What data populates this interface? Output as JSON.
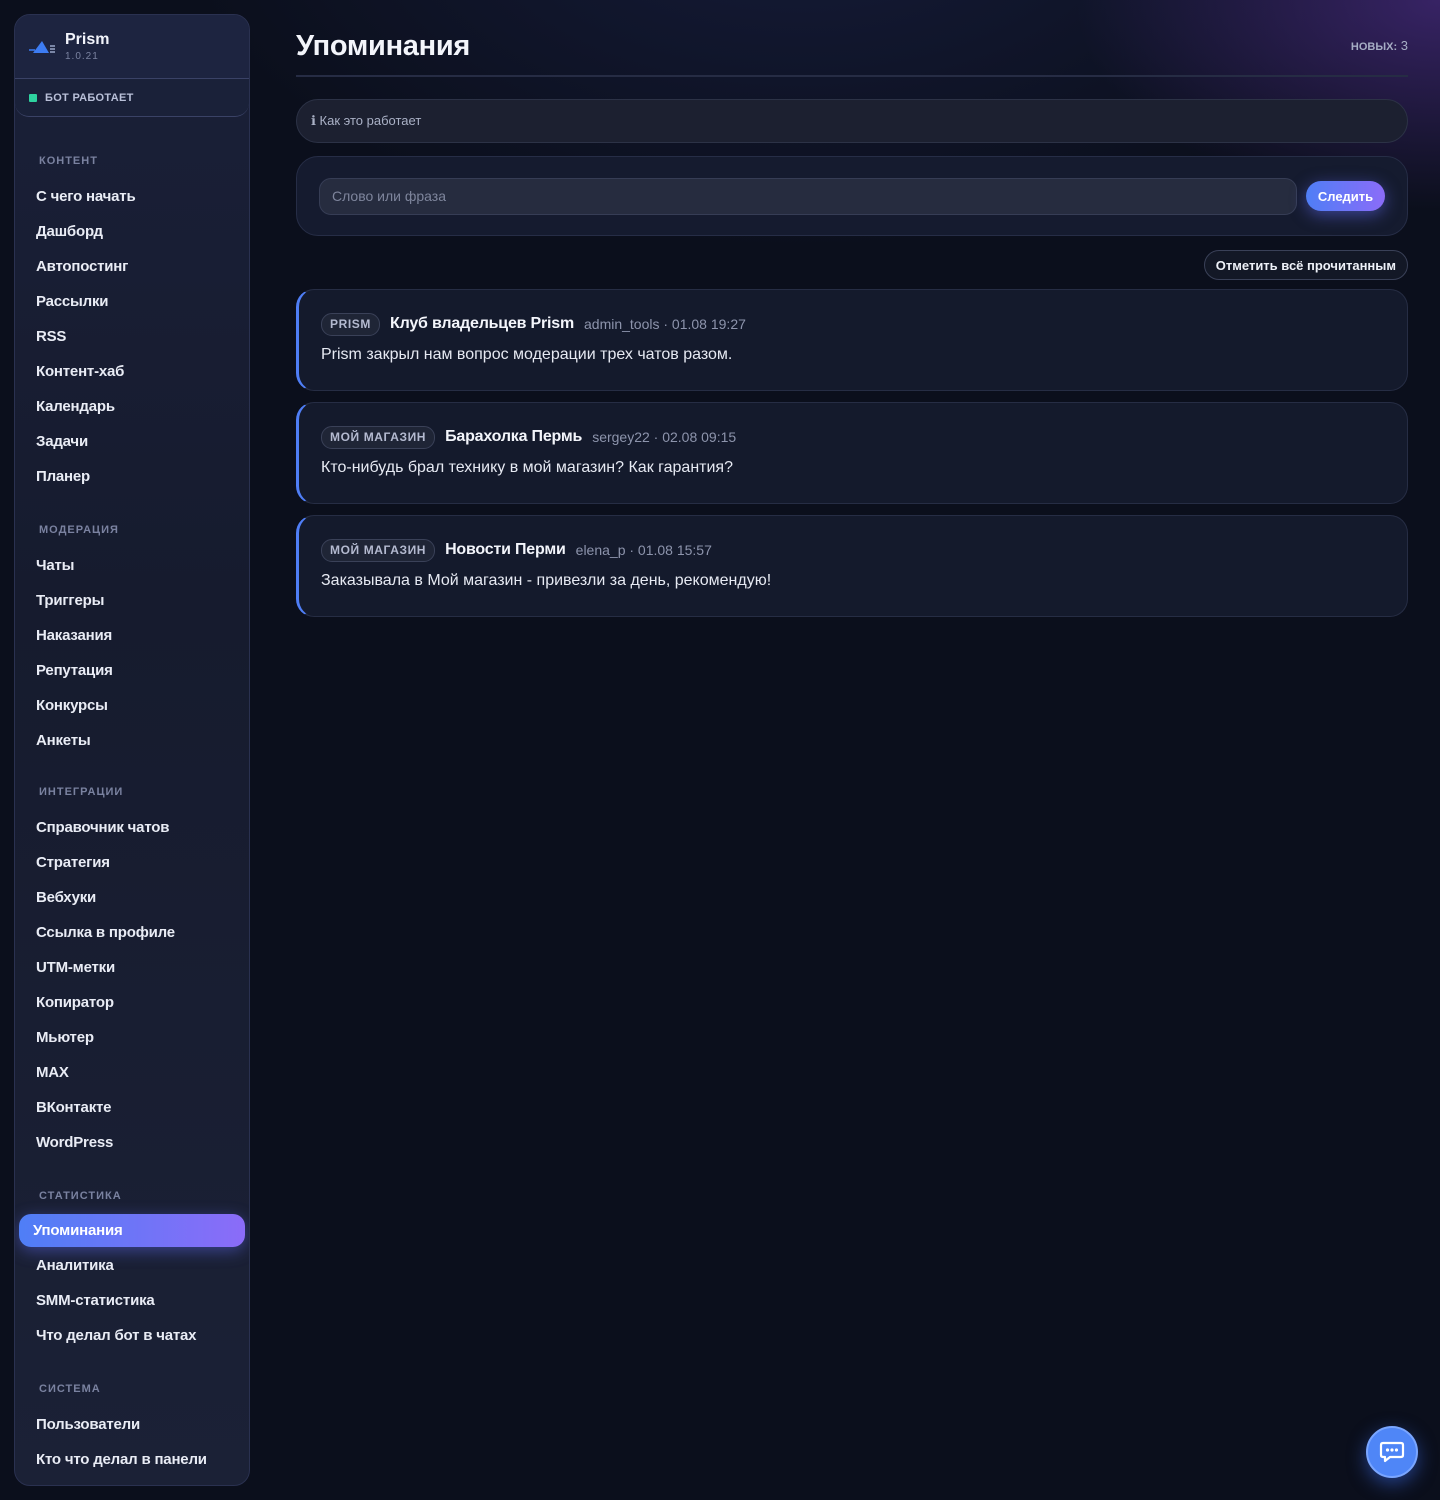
{
  "brand": {
    "name": "Prism",
    "version": "1.0.21"
  },
  "status": {
    "label": "БОТ РАБОТАЕТ",
    "color": "#2ed3a0"
  },
  "sidebar": {
    "sections": [
      {
        "title": "КОНТЕНТ",
        "items": [
          "С чего начать",
          "Дашборд",
          "Автопостинг",
          "Рассылки",
          "RSS",
          "Контент-хаб",
          "Календарь",
          "Задачи",
          "Планер"
        ]
      },
      {
        "title": "МОДЕРАЦИЯ",
        "items": [
          "Чаты",
          "Триггеры",
          "Наказания",
          "Репутация",
          "Конкурсы",
          "Анкеты"
        ]
      },
      {
        "title": "ИНТЕГРАЦИИ",
        "items": [
          "Справочник чатов",
          "Стратегия",
          "Вебхуки",
          "Ссылка в профиле",
          "UTM-метки",
          "Копиратор",
          "Мьютер",
          "MAX",
          "ВКонтакте",
          "WordPress"
        ]
      },
      {
        "title": "СТАТИСТИКА",
        "items": [
          "Упоминания",
          "Аналитика",
          "SMM-статистика",
          "Что делал бот в чатах"
        ]
      },
      {
        "title": "СИСТЕМА",
        "items": [
          "Пользователи",
          "Кто что делал в панели"
        ]
      }
    ],
    "active_item": "Упоминания"
  },
  "page": {
    "title": "Упоминания",
    "new_label": "НОВЫХ:",
    "new_count": "3",
    "how_it_works": "ℹ Как это работает",
    "follow_placeholder": "Слово или фраза",
    "follow_value": "",
    "follow_button": "Следить",
    "mark_all_button": "Отметить всё прочитанным"
  },
  "mentions": [
    {
      "badge": "PRISM",
      "chat": "Клуб владельцев Prism",
      "meta": "admin_tools · 01.08 19:27",
      "text": "Prism закрыл нам вопрос модерации трех чатов разом."
    },
    {
      "badge": "МОЙ МАГАЗИН",
      "chat": "Барахолка Пермь",
      "meta": "sergey22 · 02.08 09:15",
      "text": "Кто-нибудь брал технику в мой магазин? Как гарантия?"
    },
    {
      "badge": "МОЙ МАГАЗИН",
      "chat": "Новости Перми",
      "meta": "elena_p · 01.08 15:57",
      "text": "Заказывала в Мой магазин - привезли за день, рекомендую!"
    }
  ],
  "colors": {
    "accent_start": "#4f7ef6",
    "accent_end": "#8b6cf8",
    "background": "#0b0f1c"
  },
  "icons": {
    "brand": "prism-logo-icon",
    "fab": "chat-bubble-icon"
  }
}
